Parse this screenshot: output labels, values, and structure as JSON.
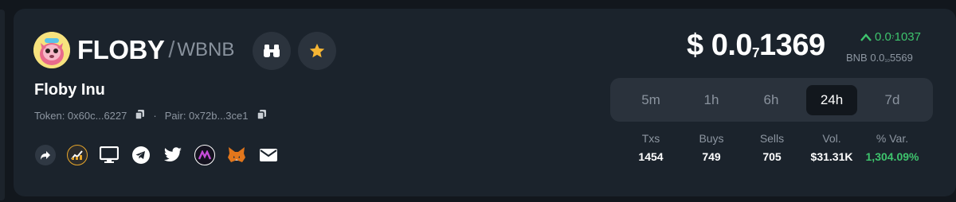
{
  "token": {
    "symbol": "FLOBY",
    "slash": "/",
    "pair_symbol": "WBNB",
    "name": "Floby Inu",
    "token_address": "Token: 0x60c...6227",
    "separator": "·",
    "pair_address": "Pair: 0x72b...3ce1",
    "avatar_icon": "floby-dog-avatar"
  },
  "actions": {
    "binoculars_icon": "binoculars-icon",
    "star_icon": "star-icon",
    "star_color": "#f5b534"
  },
  "socials": [
    "share-icon",
    "chart-logo-icon",
    "website-icon",
    "telegram-icon",
    "twitter-icon",
    "marketcap-logo-icon",
    "metamask-icon",
    "email-icon"
  ],
  "price": {
    "prefix": "$ 0.0",
    "zeros": "7",
    "digits": "1369",
    "change_arrow": "^",
    "change_prefix": "0.0",
    "change_zeros": "7",
    "change_digits": "1037",
    "bnb_prefix": "BNB 0.0",
    "bnb_zeros": "10",
    "bnb_digits": "5569",
    "up_color": "#3ec46d"
  },
  "timeframes": [
    {
      "label": "5m",
      "active": false
    },
    {
      "label": "1h",
      "active": false
    },
    {
      "label": "6h",
      "active": false
    },
    {
      "label": "24h",
      "active": true
    },
    {
      "label": "7d",
      "active": false
    }
  ],
  "stats": [
    {
      "label": "Txs",
      "value": "1454"
    },
    {
      "label": "Buys",
      "value": "749"
    },
    {
      "label": "Sells",
      "value": "705"
    },
    {
      "label": "Vol.",
      "value": "$31.31K"
    },
    {
      "label": "% Var.",
      "value": "1,304.09%"
    }
  ]
}
